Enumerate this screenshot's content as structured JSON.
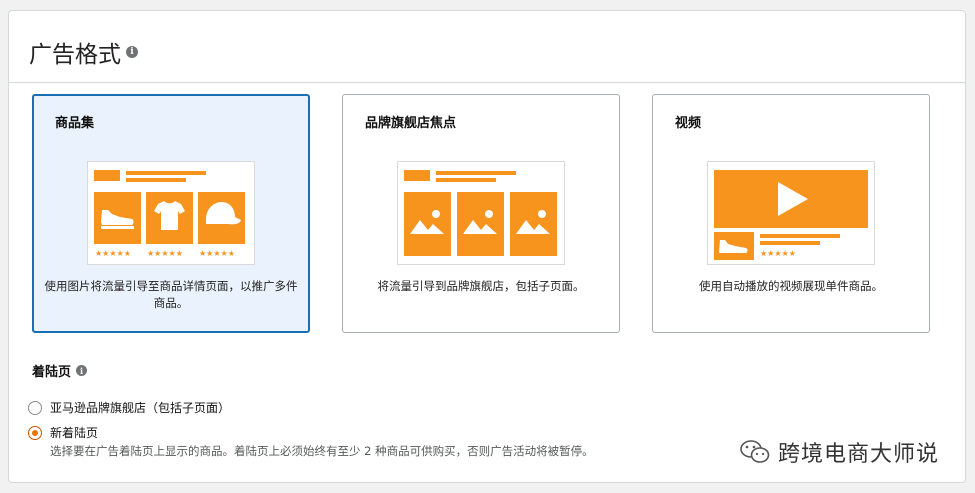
{
  "section": {
    "title": "广告格式",
    "info": "i"
  },
  "cards": [
    {
      "title": "商品集",
      "description": "使用图片将流量引导至商品详情页面，以推广多件商品。",
      "selected": true,
      "stars": "★★★★★"
    },
    {
      "title": "品牌旗舰店焦点",
      "description": "将流量引导到品牌旗舰店，包括子页面。",
      "selected": false
    },
    {
      "title": "视频",
      "description": "使用自动播放的视频展现单件商品。",
      "selected": false,
      "stars": "★★★★★"
    }
  ],
  "landing": {
    "label": "着陆页",
    "info": "i",
    "options": [
      {
        "label": "亚马逊品牌旗舰店（包括子页面）",
        "checked": false
      },
      {
        "label": "新着陆页",
        "checked": true
      }
    ],
    "hint": "选择要在广告着陆页上显示的商品。着陆页上必须始终有至少 2 种商品可供购买，否则广告活动将被暂停。"
  },
  "watermark": {
    "text": "跨境电商大师说"
  },
  "colors": {
    "accent_orange": "#f7941d",
    "selected_border": "#1a6fb3",
    "selected_bg": "#eaf3fd",
    "radio_orange": "#e77600"
  }
}
